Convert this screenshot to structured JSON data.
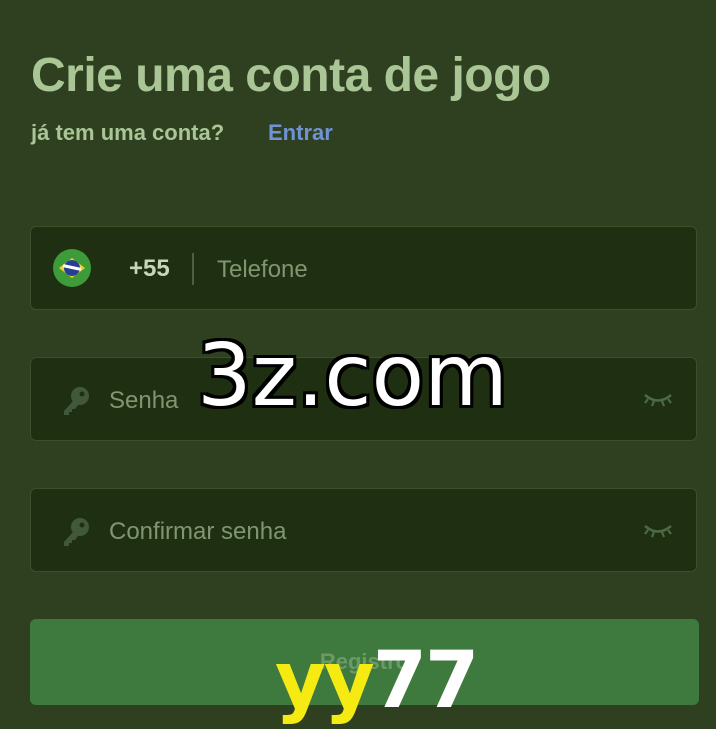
{
  "header": {
    "title": "Crie uma conta de jogo",
    "subtitle": "já tem uma conta?",
    "login_link": "Entrar"
  },
  "form": {
    "phone": {
      "country_flag": "brazil-flag-icon",
      "dial_code": "+55",
      "placeholder": "Telefone",
      "value": ""
    },
    "password": {
      "icon": "key-icon",
      "placeholder": "Senha",
      "value": "",
      "toggle_icon": "eye-closed-icon"
    },
    "confirm_password": {
      "icon": "key-icon",
      "placeholder": "Confirmar senha",
      "value": "",
      "toggle_icon": "eye-closed-icon"
    },
    "submit_label": "Registro"
  },
  "watermarks": {
    "center": "3z.com",
    "bottom_yellow": "yy",
    "bottom_white": "77"
  },
  "colors": {
    "background": "#2e401f",
    "field_background": "#1f2f12",
    "title": "#aac596",
    "link": "#6f93d5",
    "button": "#3e7a3e"
  }
}
